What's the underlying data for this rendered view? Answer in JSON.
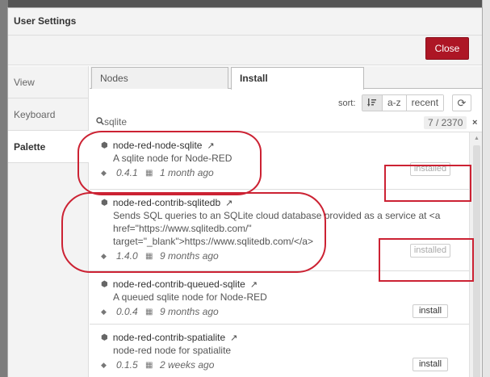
{
  "dialog": {
    "title": "User Settings",
    "close_label": "Close"
  },
  "sidebar": {
    "items": [
      {
        "label": "View",
        "active": false
      },
      {
        "label": "Keyboard",
        "active": false
      },
      {
        "label": "Palette",
        "active": true
      }
    ]
  },
  "tabs": [
    {
      "label": "Nodes"
    },
    {
      "label": "Install"
    }
  ],
  "sort": {
    "label": "sort:",
    "options": [
      {
        "label": "",
        "icon": "sort-relevance-icon"
      },
      {
        "label": "a-z"
      },
      {
        "label": "recent"
      }
    ],
    "refresh_icon": "refresh-icon"
  },
  "search": {
    "value": "sqlite",
    "count": "7 / 2370",
    "clear_icon": "×"
  },
  "packages": [
    {
      "name": "node-red-node-sqlite",
      "desc": "A sqlite node for Node-RED",
      "version": "0.4.1",
      "updated": "1 month ago",
      "status": "installed"
    },
    {
      "name": "node-red-contrib-sqlitedb",
      "desc": "Sends SQL queries to an SQLite cloud database provided as a service at <a href=\"https://www.sqlitedb.com/\" target=\"_blank\">https://www.sqlitedb.com/</a>",
      "version": "1.4.0",
      "updated": "9 months ago",
      "status": "installed"
    },
    {
      "name": "node-red-contrib-queued-sqlite",
      "desc": "A queued sqlite node for Node-RED",
      "version": "0.0.4",
      "updated": "9 months ago",
      "status": "install"
    },
    {
      "name": "node-red-contrib-spatialite",
      "desc": "node-red node for spatialite",
      "version": "0.1.5",
      "updated": "2 weeks ago",
      "status": "install"
    }
  ],
  "colors": {
    "accent": "#ad1625",
    "annotation": "#cc2233"
  }
}
